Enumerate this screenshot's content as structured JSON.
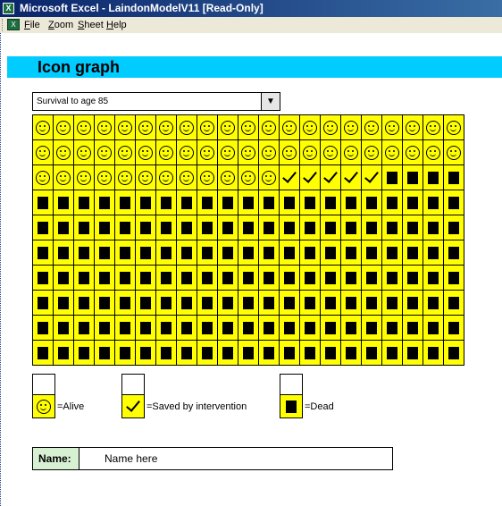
{
  "window": {
    "title": "Microsoft Excel - LaindonModelV11  [Read-Only]",
    "app_icon": "excel-icon"
  },
  "menu": {
    "doc_icon": "workbook-icon",
    "items": [
      {
        "label": "File"
      },
      {
        "label": "Zoom"
      },
      {
        "label": "Sheet"
      },
      {
        "label": "Help"
      }
    ]
  },
  "page": {
    "title": "Icon graph",
    "banner_color": "#00ccff"
  },
  "dropdown": {
    "selected": "Survival to age 85",
    "button": "▼"
  },
  "icon_graph": {
    "columns": 21,
    "cell_color": "#ffff00",
    "rows": [
      [
        "alive",
        "alive",
        "alive",
        "alive",
        "alive",
        "alive",
        "alive",
        "alive",
        "alive",
        "alive",
        "alive",
        "alive",
        "alive",
        "alive",
        "alive",
        "alive",
        "alive",
        "alive",
        "alive",
        "alive",
        "alive"
      ],
      [
        "alive",
        "alive",
        "alive",
        "alive",
        "alive",
        "alive",
        "alive",
        "alive",
        "alive",
        "alive",
        "alive",
        "alive",
        "alive",
        "alive",
        "alive",
        "alive",
        "alive",
        "alive",
        "alive",
        "alive",
        "alive"
      ],
      [
        "alive",
        "alive",
        "alive",
        "alive",
        "alive",
        "alive",
        "alive",
        "alive",
        "alive",
        "alive",
        "alive",
        "alive",
        "saved",
        "saved",
        "saved",
        "saved",
        "saved",
        "dead",
        "dead",
        "dead",
        "dead"
      ],
      [
        "dead",
        "dead",
        "dead",
        "dead",
        "dead",
        "dead",
        "dead",
        "dead",
        "dead",
        "dead",
        "dead",
        "dead",
        "dead",
        "dead",
        "dead",
        "dead",
        "dead",
        "dead",
        "dead",
        "dead",
        "dead"
      ],
      [
        "dead",
        "dead",
        "dead",
        "dead",
        "dead",
        "dead",
        "dead",
        "dead",
        "dead",
        "dead",
        "dead",
        "dead",
        "dead",
        "dead",
        "dead",
        "dead",
        "dead",
        "dead",
        "dead",
        "dead",
        "dead"
      ],
      [
        "dead",
        "dead",
        "dead",
        "dead",
        "dead",
        "dead",
        "dead",
        "dead",
        "dead",
        "dead",
        "dead",
        "dead",
        "dead",
        "dead",
        "dead",
        "dead",
        "dead",
        "dead",
        "dead",
        "dead",
        "dead"
      ],
      [
        "dead",
        "dead",
        "dead",
        "dead",
        "dead",
        "dead",
        "dead",
        "dead",
        "dead",
        "dead",
        "dead",
        "dead",
        "dead",
        "dead",
        "dead",
        "dead",
        "dead",
        "dead",
        "dead",
        "dead",
        "dead"
      ],
      [
        "dead",
        "dead",
        "dead",
        "dead",
        "dead",
        "dead",
        "dead",
        "dead",
        "dead",
        "dead",
        "dead",
        "dead",
        "dead",
        "dead",
        "dead",
        "dead",
        "dead",
        "dead",
        "dead",
        "dead",
        "dead"
      ],
      [
        "dead",
        "dead",
        "dead",
        "dead",
        "dead",
        "dead",
        "dead",
        "dead",
        "dead",
        "dead",
        "dead",
        "dead",
        "dead",
        "dead",
        "dead",
        "dead",
        "dead",
        "dead",
        "dead",
        "dead",
        "dead"
      ],
      [
        "dead",
        "dead",
        "dead",
        "dead",
        "dead",
        "dead",
        "dead",
        "dead",
        "dead",
        "dead",
        "dead",
        "dead",
        "dead",
        "dead",
        "dead",
        "dead",
        "dead",
        "dead",
        "dead",
        "dead",
        "dead"
      ]
    ]
  },
  "legend": {
    "alive": {
      "icon": "smiley-icon",
      "label": "=Alive"
    },
    "saved": {
      "icon": "checkmark-icon",
      "label": "=Saved by intervention"
    },
    "dead": {
      "icon": "black-square-icon",
      "label": "=Dead"
    }
  },
  "name": {
    "label": "Name:",
    "value": "Name here"
  }
}
